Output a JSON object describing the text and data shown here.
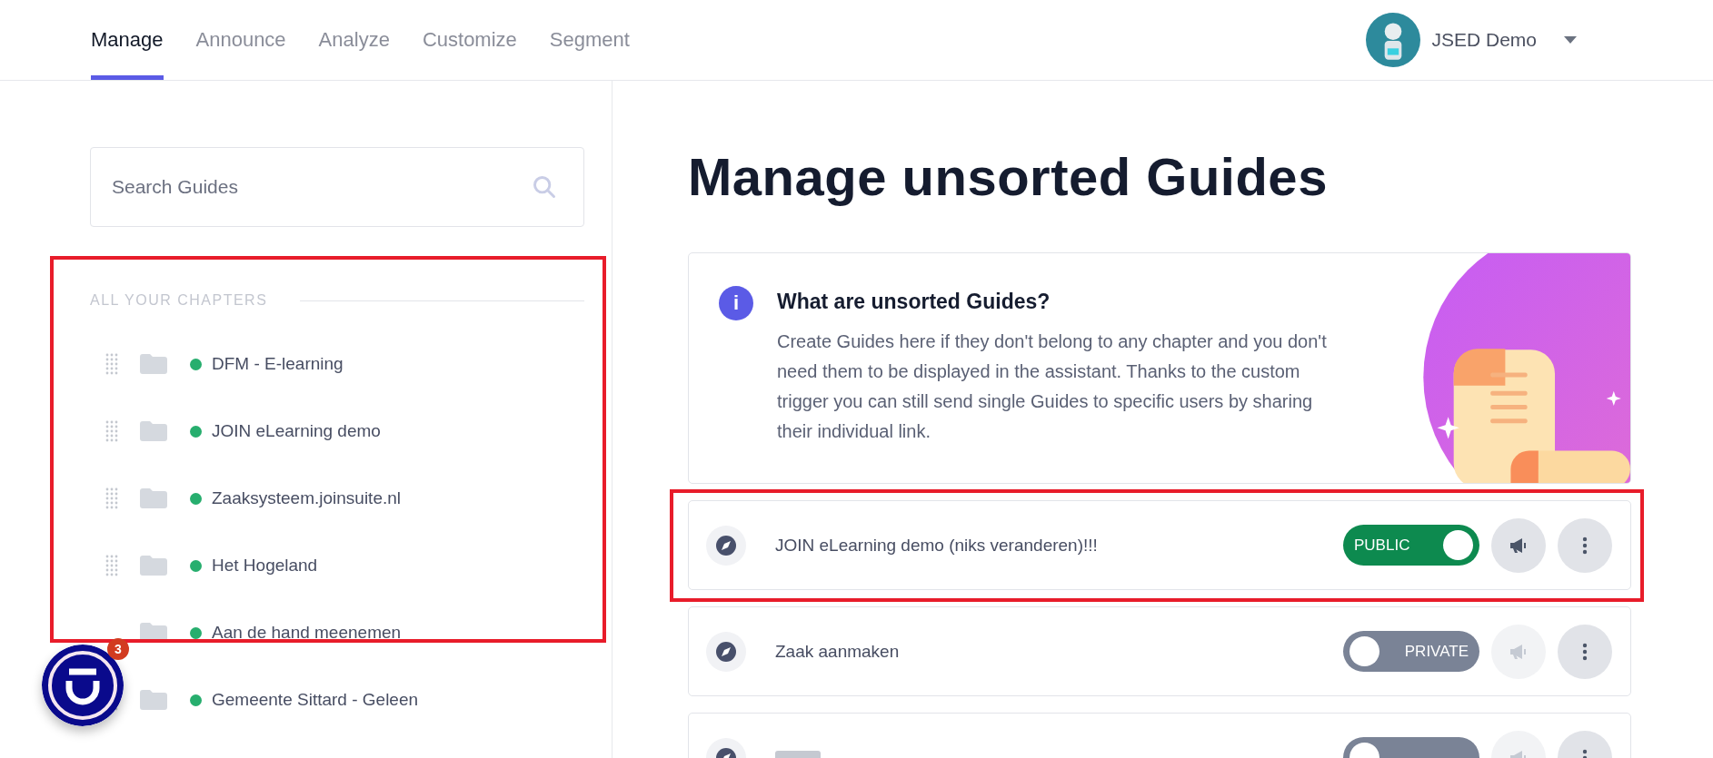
{
  "nav": {
    "tabs": [
      {
        "label": "Manage",
        "selected": true
      },
      {
        "label": "Announce",
        "selected": false
      },
      {
        "label": "Analyze",
        "selected": false
      },
      {
        "label": "Customize",
        "selected": false
      },
      {
        "label": "Segment",
        "selected": false
      }
    ],
    "account": {
      "name": "JSED Demo"
    }
  },
  "sidebar": {
    "search": {
      "placeholder": "Search Guides"
    },
    "section_title": "ALL YOUR CHAPTERS",
    "highlighted": true,
    "chapters": [
      {
        "title": "DFM - E-learning",
        "color": "#27ae6e"
      },
      {
        "title": "JOIN eLearning demo",
        "color": "#27ae6e"
      },
      {
        "title": "Zaaksysteem.joinsuite.nl",
        "color": "#27ae6e"
      },
      {
        "title": "Het Hogeland",
        "color": "#27ae6e"
      },
      {
        "title": "Aan de hand meenemen",
        "color": "#27ae6e",
        "drag_handle": false
      },
      {
        "title": "Gemeente Sittard - Geleen",
        "color": "#27ae6e"
      }
    ]
  },
  "help_widget": {
    "badge": "3"
  },
  "main": {
    "title": "Manage unsorted Guides",
    "info": {
      "icon_text": "i",
      "heading": "What are unsorted Guides?",
      "text": "Create Guides here if they don't belong to any chapter and you don't need them to be displayed in the assistant. Thanks to the custom trigger you can still send single Guides to specific users by sharing their individual link."
    },
    "guides": [
      {
        "title": "JOIN eLearning demo (niks veranderen)!!!",
        "public": true,
        "toggle_label": "PUBLIC",
        "highlighted": true
      },
      {
        "title": "Zaak aanmaken",
        "public": false,
        "toggle_label": "PRIVATE",
        "highlighted": false
      },
      {
        "public": false,
        "highlighted": false,
        "tag": true
      }
    ]
  }
}
